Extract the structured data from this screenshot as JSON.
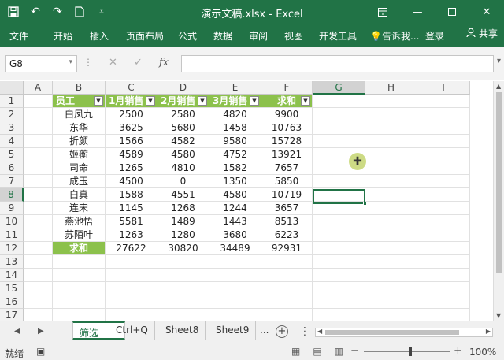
{
  "titlebar": {
    "title": "演示文稿.xlsx - Excel",
    "save_icon": "save-icon",
    "undo_icon": "undo-icon",
    "redo_icon": "redo-icon",
    "new_icon": "new-file-icon",
    "customize_icon": "customize-qat-icon",
    "controls": [
      "ribbon-display-icon",
      "minimize-icon",
      "maximize-icon",
      "close-icon"
    ]
  },
  "ribbon": {
    "tabs": [
      "文件",
      "开始",
      "插入",
      "页面布局",
      "公式",
      "数据",
      "审阅",
      "视图",
      "开发工具"
    ],
    "tell_me": "告诉我...",
    "login": "登录",
    "share": "共享",
    "accent": "#217346"
  },
  "formula_bar": {
    "name_box": "G8",
    "cancel_icon": "✕",
    "enter_icon": "✓",
    "fx_label": "fx",
    "formula": ""
  },
  "sheet": {
    "columns": [
      "A",
      "B",
      "C",
      "D",
      "E",
      "F",
      "G",
      "H",
      "I"
    ],
    "selected_column": "G",
    "rows": [
      "1",
      "2",
      "3",
      "4",
      "5",
      "6",
      "7",
      "8",
      "9",
      "10",
      "11",
      "12",
      "13",
      "14",
      "15",
      "16",
      "17"
    ],
    "selected_row": "8",
    "header_color": "#8cc14c",
    "headers": [
      "员工",
      "1月销售",
      "2月销售",
      "3月销售",
      "求和"
    ],
    "data": [
      [
        "白凤九",
        "2500",
        "2580",
        "4820",
        "9900"
      ],
      [
        "东华",
        "3625",
        "5680",
        "1458",
        "10763"
      ],
      [
        "折颜",
        "1566",
        "4582",
        "9580",
        "15728"
      ],
      [
        "姬蘅",
        "4589",
        "4580",
        "4752",
        "13921"
      ],
      [
        "司命",
        "1265",
        "4810",
        "1582",
        "7657"
      ],
      [
        "成玉",
        "4500",
        "0",
        "1350",
        "5850"
      ],
      [
        "白真",
        "1588",
        "4551",
        "4580",
        "10719"
      ],
      [
        "连宋",
        "1145",
        "1268",
        "1244",
        "3657"
      ],
      [
        "燕池悟",
        "5581",
        "1489",
        "1443",
        "8513"
      ],
      [
        "苏陌叶",
        "1263",
        "1280",
        "3680",
        "6223"
      ]
    ],
    "total_row": [
      "求和",
      "27622",
      "30820",
      "34489",
      "92931"
    ],
    "active_cell": "G8"
  },
  "sheet_tabs": {
    "tabs": [
      "筛选",
      "Ctrl+Q",
      "Sheet8",
      "Sheet9"
    ],
    "active": "筛选",
    "more": "..."
  },
  "status": {
    "text": "就绪",
    "zoom": "100%"
  }
}
